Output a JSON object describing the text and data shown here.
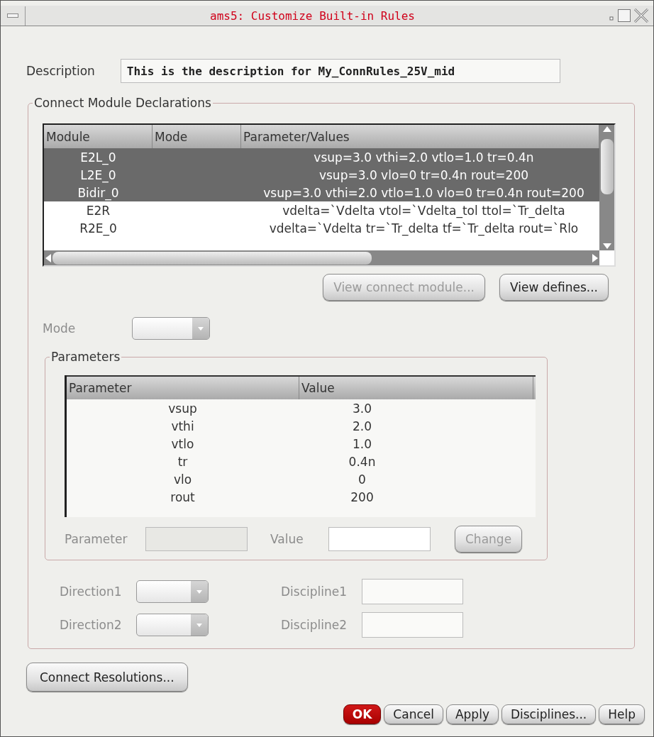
{
  "window": {
    "title": "ams5: Customize Built-in Rules"
  },
  "description": {
    "label": "Description",
    "value": "This is the description for My_ConnRules_25V_mid"
  },
  "declarations": {
    "title": "Connect Module Declarations",
    "columns": [
      "Module",
      "Mode",
      "Parameter/Values"
    ],
    "rows": [
      {
        "module": "E2L_0",
        "values": "vsup=3.0 vthi=2.0 vtlo=1.0 tr=0.4n",
        "selected": true
      },
      {
        "module": "L2E_0",
        "values": "vsup=3.0 vlo=0 tr=0.4n rout=200",
        "selected": true
      },
      {
        "module": "Bidir_0",
        "values": "vsup=3.0 vthi=2.0 vtlo=1.0 vlo=0 tr=0.4n rout=200",
        "selected": true
      },
      {
        "module": "E2R",
        "values": "vdelta=`Vdelta vtol=`Vdelta_tol ttol=`Tr_delta",
        "selected": false
      },
      {
        "module": "R2E_0",
        "values": "vdelta=`Vdelta tr=`Tr_delta tf=`Tr_delta rout=`Rlo",
        "selected": false
      }
    ]
  },
  "actions": [
    {
      "label": "View connect module...",
      "disabled": true
    },
    {
      "label": "View defines...",
      "disabled": false
    }
  ],
  "mode": {
    "label": "Mode",
    "disabled": true
  },
  "parameters": {
    "title": "Parameters",
    "columns": [
      "Parameter",
      "Value"
    ],
    "rows": [
      {
        "parameter": "vsup",
        "value": "3.0"
      },
      {
        "parameter": "vthi",
        "value": "2.0"
      },
      {
        "parameter": "vtlo",
        "value": "1.0"
      },
      {
        "parameter": "tr",
        "value": "0.4n"
      },
      {
        "parameter": "vlo",
        "value": "0"
      },
      {
        "parameter": "rout",
        "value": "200"
      }
    ],
    "parameter_field": {
      "label": "Parameter",
      "disabled": true
    },
    "value_field": {
      "label": "Value",
      "disabled": false
    },
    "change": {
      "label": "Change",
      "disabled": true
    }
  },
  "directions": [
    {
      "label": "Direction1",
      "discipline_label": "Discipline1"
    },
    {
      "label": "Direction2",
      "discipline_label": "Discipline2"
    }
  ],
  "connect_resolutions": {
    "label": "Connect Resolutions..."
  },
  "footer_buttons": [
    {
      "label": "OK",
      "kind": "default"
    },
    {
      "label": "Cancel",
      "kind": "normal"
    },
    {
      "label": "Apply",
      "kind": "normal"
    },
    {
      "label": "Disciplines...",
      "kind": "normal"
    },
    {
      "label": "Help",
      "kind": "normal"
    }
  ]
}
